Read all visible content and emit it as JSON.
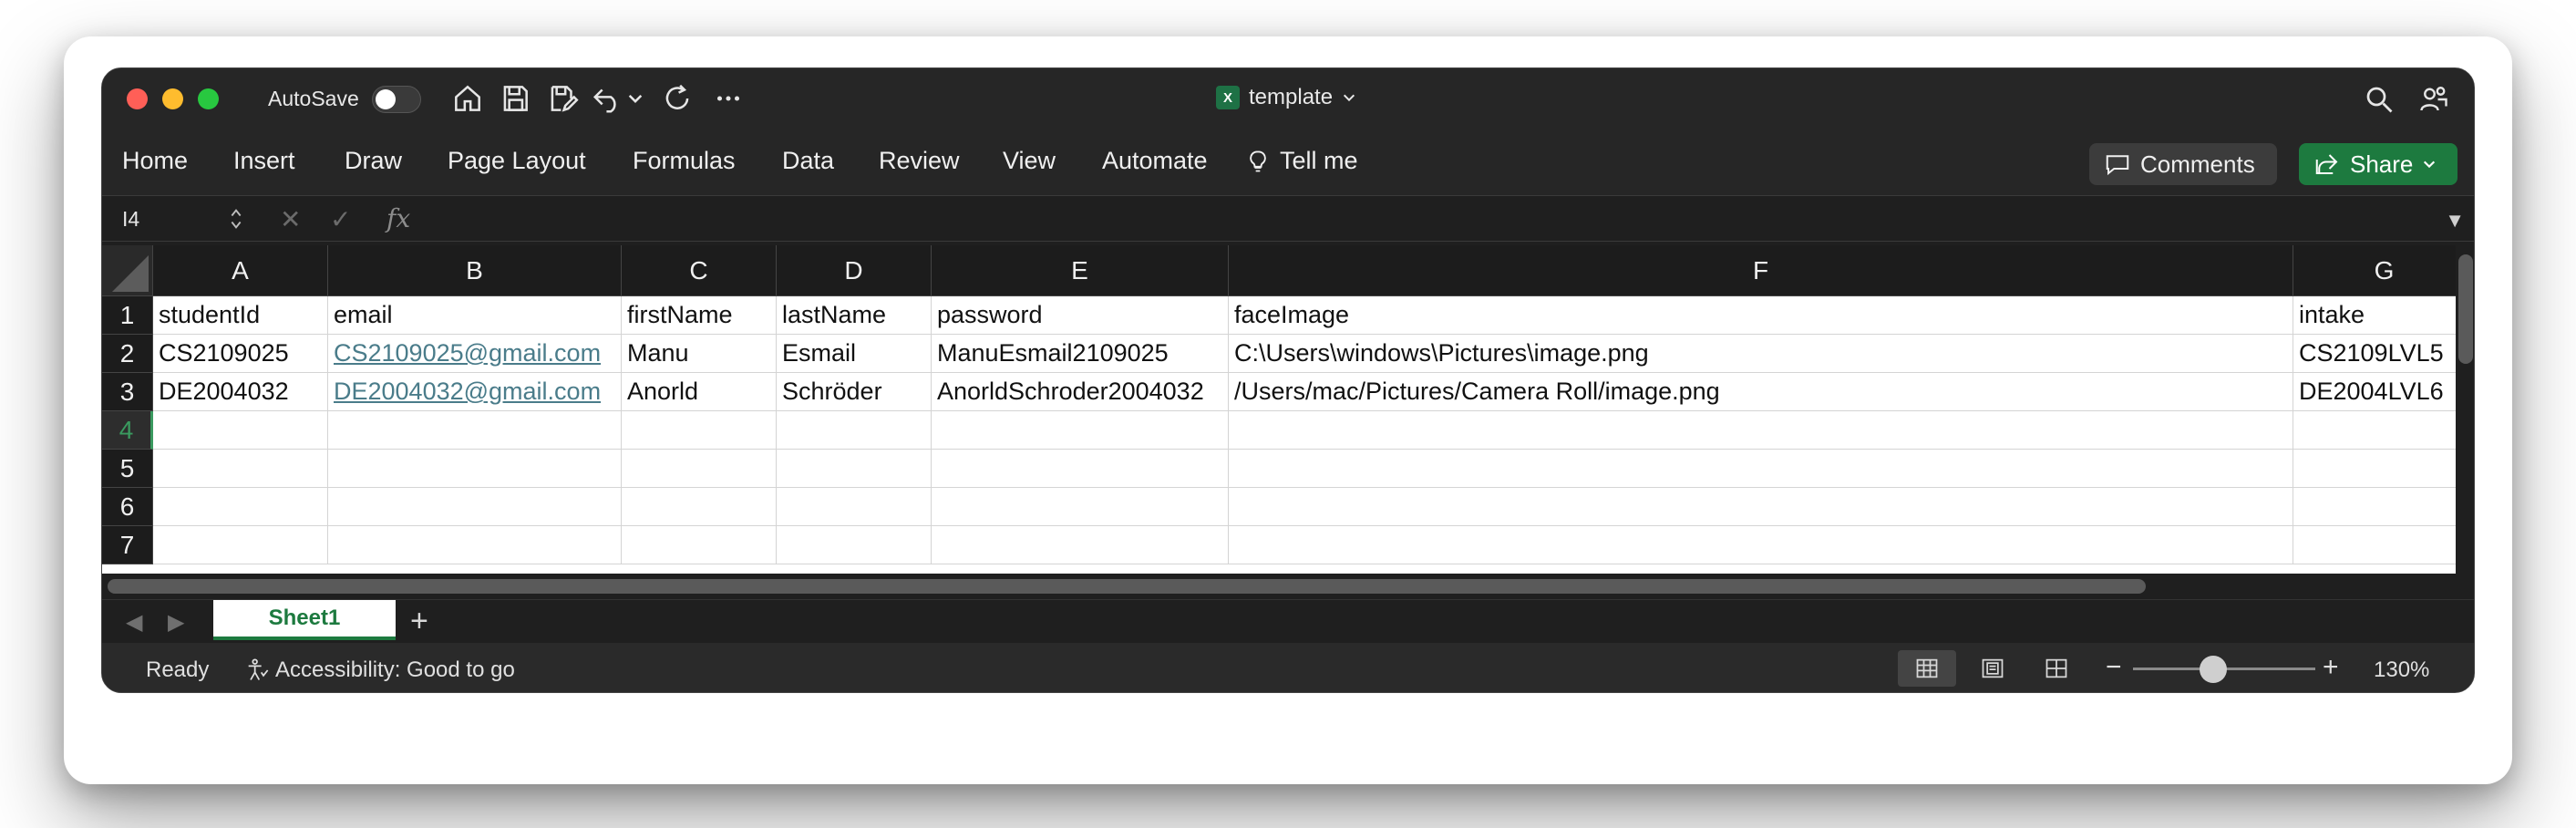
{
  "titlebar": {
    "autosave_label": "AutoSave",
    "doc_title": "template",
    "doc_badge": "X"
  },
  "ribbon": {
    "tabs": [
      "Home",
      "Insert",
      "Draw",
      "Page Layout",
      "Formulas",
      "Data",
      "Review",
      "View",
      "Automate",
      "Tell me"
    ],
    "comments_label": "Comments",
    "share_label": "Share"
  },
  "formula_bar": {
    "name_box": "I4",
    "fx": "fx",
    "formula": ""
  },
  "grid": {
    "columns": [
      "A",
      "B",
      "C",
      "D",
      "E",
      "F",
      "G"
    ],
    "row_numbers": [
      "1",
      "2",
      "3",
      "4",
      "5",
      "6",
      "7"
    ],
    "selected_row": "4",
    "rows": [
      [
        "studentId",
        "email",
        "firstName",
        "lastName",
        "password",
        "faceImage",
        "intake"
      ],
      [
        "CS2109025",
        "CS2109025@gmail.com",
        "Manu",
        "Esmail",
        "ManuEsmail2109025",
        "C:\\Users\\windows\\Pictures\\image.png",
        "CS2109LVL5"
      ],
      [
        "DE2004032",
        "DE2004032@gmail.com",
        "Anorld",
        "Schröder",
        "AnorldSchroder2004032",
        "/Users/mac/Pictures/Camera Roll/image.png",
        "DE2004LVL6"
      ],
      [
        "",
        "",
        "",
        "",
        "",
        "",
        ""
      ],
      [
        "",
        "",
        "",
        "",
        "",
        "",
        ""
      ],
      [
        "",
        "",
        "",
        "",
        "",
        "",
        ""
      ],
      [
        "",
        "",
        "",
        "",
        "",
        "",
        ""
      ]
    ]
  },
  "sheets": {
    "active": "Sheet1",
    "add_label": "+"
  },
  "status": {
    "ready": "Ready",
    "accessibility": "Accessibility: Good to go",
    "zoom": "130%",
    "zoom_fraction": 0.44
  },
  "colors": {
    "accent_green": "#1d7a3f",
    "link": "#4a7c8a"
  }
}
